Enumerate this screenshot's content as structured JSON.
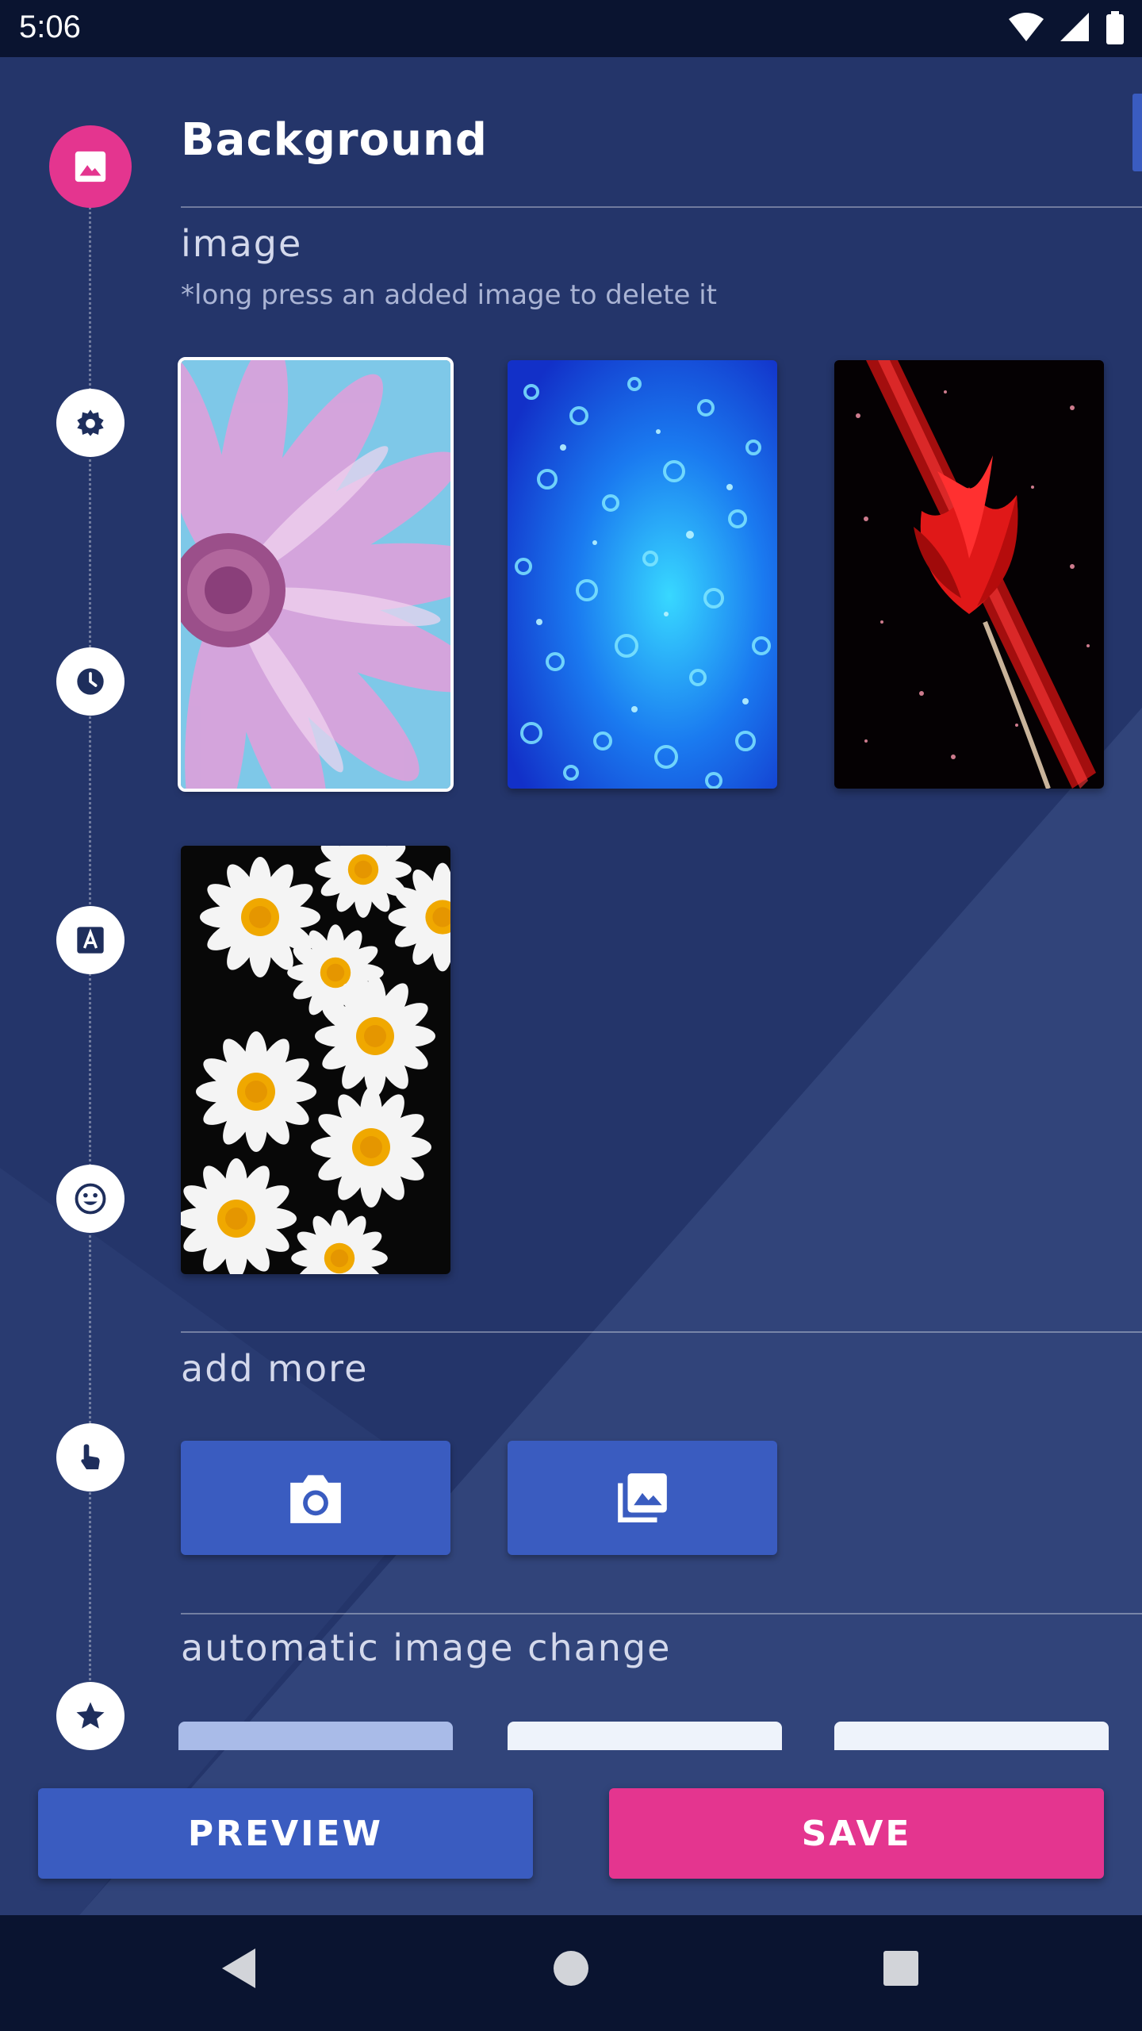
{
  "status_bar": {
    "time": "5:06",
    "icons": [
      "wifi-icon",
      "signal-icon",
      "battery-icon"
    ]
  },
  "timeline": {
    "items": [
      {
        "icon": "image-icon",
        "active": true
      },
      {
        "icon": "gear-icon",
        "active": false
      },
      {
        "icon": "clock-icon",
        "active": false
      },
      {
        "icon": "text-a-icon",
        "active": false
      },
      {
        "icon": "emoji-icon",
        "active": false
      },
      {
        "icon": "touch-icon",
        "active": false
      },
      {
        "icon": "star-icon",
        "active": false
      }
    ]
  },
  "section": {
    "title": "Background"
  },
  "image_section": {
    "title": "image",
    "hint": "*long press an added image to delete it",
    "thumbnails": [
      {
        "name": "pink-daisy",
        "selected": true
      },
      {
        "name": "blue-bokeh",
        "selected": false
      },
      {
        "name": "red-tulip",
        "selected": false
      },
      {
        "name": "white-daisies",
        "selected": false
      }
    ]
  },
  "add_more": {
    "title": "add more",
    "buttons": [
      {
        "icon": "camera-icon"
      },
      {
        "icon": "gallery-icon"
      }
    ]
  },
  "auto_change": {
    "title": "automatic image change"
  },
  "actions": {
    "preview_label": "PREVIEW",
    "save_label": "SAVE"
  },
  "nav_bar": {
    "icons": [
      "back-icon",
      "home-icon",
      "recents-icon"
    ]
  },
  "colors": {
    "background": "#2a3c70",
    "accent_pink": "#e4358f",
    "accent_blue": "#3a5cc0",
    "system_bar": "#0a1430"
  }
}
